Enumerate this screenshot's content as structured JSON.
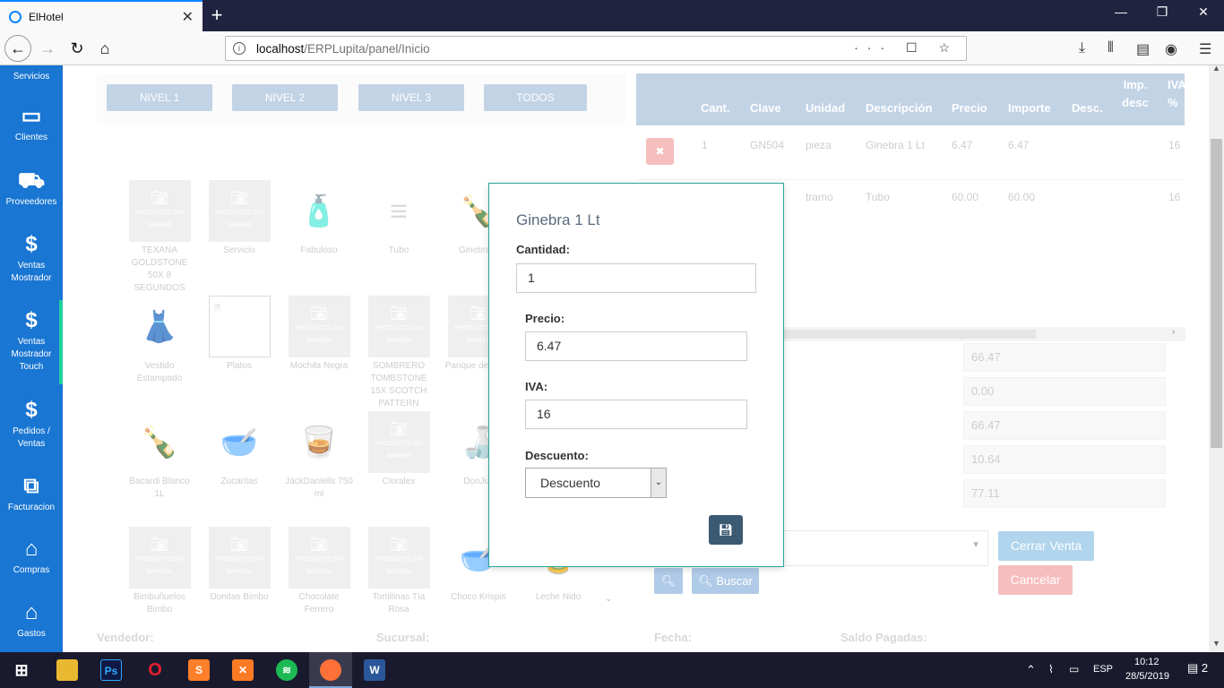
{
  "browser": {
    "tab_title": "ElHotel",
    "url_host": "localhost",
    "url_path": "/ERPLupita/panel/Inicio",
    "url_actions": "··· ☐ ☆"
  },
  "sidebar": {
    "top_label": "Servicios",
    "items": [
      {
        "label": "Clientes",
        "icon": "credit-card-icon",
        "glyph": "▭"
      },
      {
        "label": "Proveedores",
        "icon": "truck-icon",
        "glyph": "⛟"
      },
      {
        "label": "Ventas Mostrador",
        "icon": "dollar-icon",
        "glyph": "$"
      },
      {
        "label": "Ventas Mostrador Touch",
        "icon": "dollar-icon",
        "glyph": "$"
      },
      {
        "label": "Pedidos / Ventas",
        "icon": "dollar-icon",
        "glyph": "$"
      },
      {
        "label": "Facturacion",
        "icon": "copy-icon",
        "glyph": "⧉"
      },
      {
        "label": "Compras",
        "icon": "shopping-bag-icon",
        "glyph": "⌂"
      },
      {
        "label": "Gastos",
        "icon": "shopping-bag-icon",
        "glyph": "⌂"
      }
    ]
  },
  "levels": [
    "NIVEL 1",
    "NIVEL 2",
    "NIVEL 3",
    "TODOS"
  ],
  "no_image_text": "PRODUCTO SIN IMAGEN",
  "products": [
    {
      "name": "TEXANA GOLDSTONE 50X 8 SEGUNDOS",
      "kind": "placeholder"
    },
    {
      "name": "Servicio",
      "kind": "placeholder"
    },
    {
      "name": "Fabuloso",
      "kind": "image",
      "glyph": "🧴"
    },
    {
      "name": "Tubo",
      "kind": "image",
      "glyph": "≡"
    },
    {
      "name": "Ginebra 1",
      "kind": "image",
      "glyph": "🍾"
    },
    {
      "name": "Vestido Estampado",
      "kind": "image",
      "glyph": "👗"
    },
    {
      "name": "Platos",
      "kind": "blank"
    },
    {
      "name": "Mochila Negra",
      "kind": "placeholder"
    },
    {
      "name": "SOMBRERO TOMBSTONE 15X SCOTCH PATTERN",
      "kind": "placeholder"
    },
    {
      "name": "Panque de Nuez",
      "kind": "placeholder"
    },
    {
      "name": "Bacardi Blanco 1L",
      "kind": "image",
      "glyph": "🍾"
    },
    {
      "name": "Zucaritas",
      "kind": "image",
      "glyph": "🥣"
    },
    {
      "name": "JackDaniells 750 ml",
      "kind": "image",
      "glyph": "🥃"
    },
    {
      "name": "Cloralex",
      "kind": "placeholder"
    },
    {
      "name": "DonJuli",
      "kind": "image",
      "glyph": "🍶"
    },
    {
      "name": "Bimbuñuelos Bimbo",
      "kind": "placeholder"
    },
    {
      "name": "Donitas Bimbo",
      "kind": "placeholder"
    },
    {
      "name": "Chocolate Ferrero",
      "kind": "placeholder"
    },
    {
      "name": "Tortillinas Tía Rosa",
      "kind": "placeholder"
    },
    {
      "name": "Choco Krispis",
      "kind": "image",
      "glyph": "🥣"
    },
    {
      "name": "Leche Nido",
      "kind": "image",
      "glyph": "🥫"
    }
  ],
  "table": {
    "headers": [
      "Cant.",
      "Clave",
      "Unidad",
      "Descripción",
      "Precio",
      "Importe",
      "Desc.",
      "Imp. desc",
      "IVA %"
    ],
    "rows": [
      {
        "cant": "1",
        "clave": "GN504",
        "unidad": "pieza",
        "descripcion": "Ginebra 1 Lt",
        "precio": "6.47",
        "importe": "6.47",
        "iva": "16"
      },
      {
        "unidad": "tramo",
        "descripcion": "Tubo",
        "precio": "60.00",
        "importe": "60.00",
        "iva": "16"
      }
    ]
  },
  "totals": [
    "66.47",
    "0.00",
    "66.47",
    "10.64",
    "77.11"
  ],
  "actions": {
    "cerrar_venta": "Cerrar Venta",
    "cancelar": "Cancelar",
    "buscar": "Buscar"
  },
  "bottom_labels": [
    "Vendedor:",
    "Sucursal:",
    "Fecha:",
    "Saldo Pagadas:"
  ],
  "modal": {
    "title": "Ginebra 1 Lt",
    "cantidad_label": "Cantidad:",
    "cantidad_value": "1",
    "precio_label": "Precio:",
    "precio_value": "6.47",
    "iva_label": "IVA:",
    "iva_value": "16",
    "descuento_label": "Descuento:",
    "descuento_value": "Descuento"
  },
  "taskbar": {
    "lang": "ESP",
    "time": "10:12",
    "date": "28/5/2019",
    "notifications": "2"
  }
}
